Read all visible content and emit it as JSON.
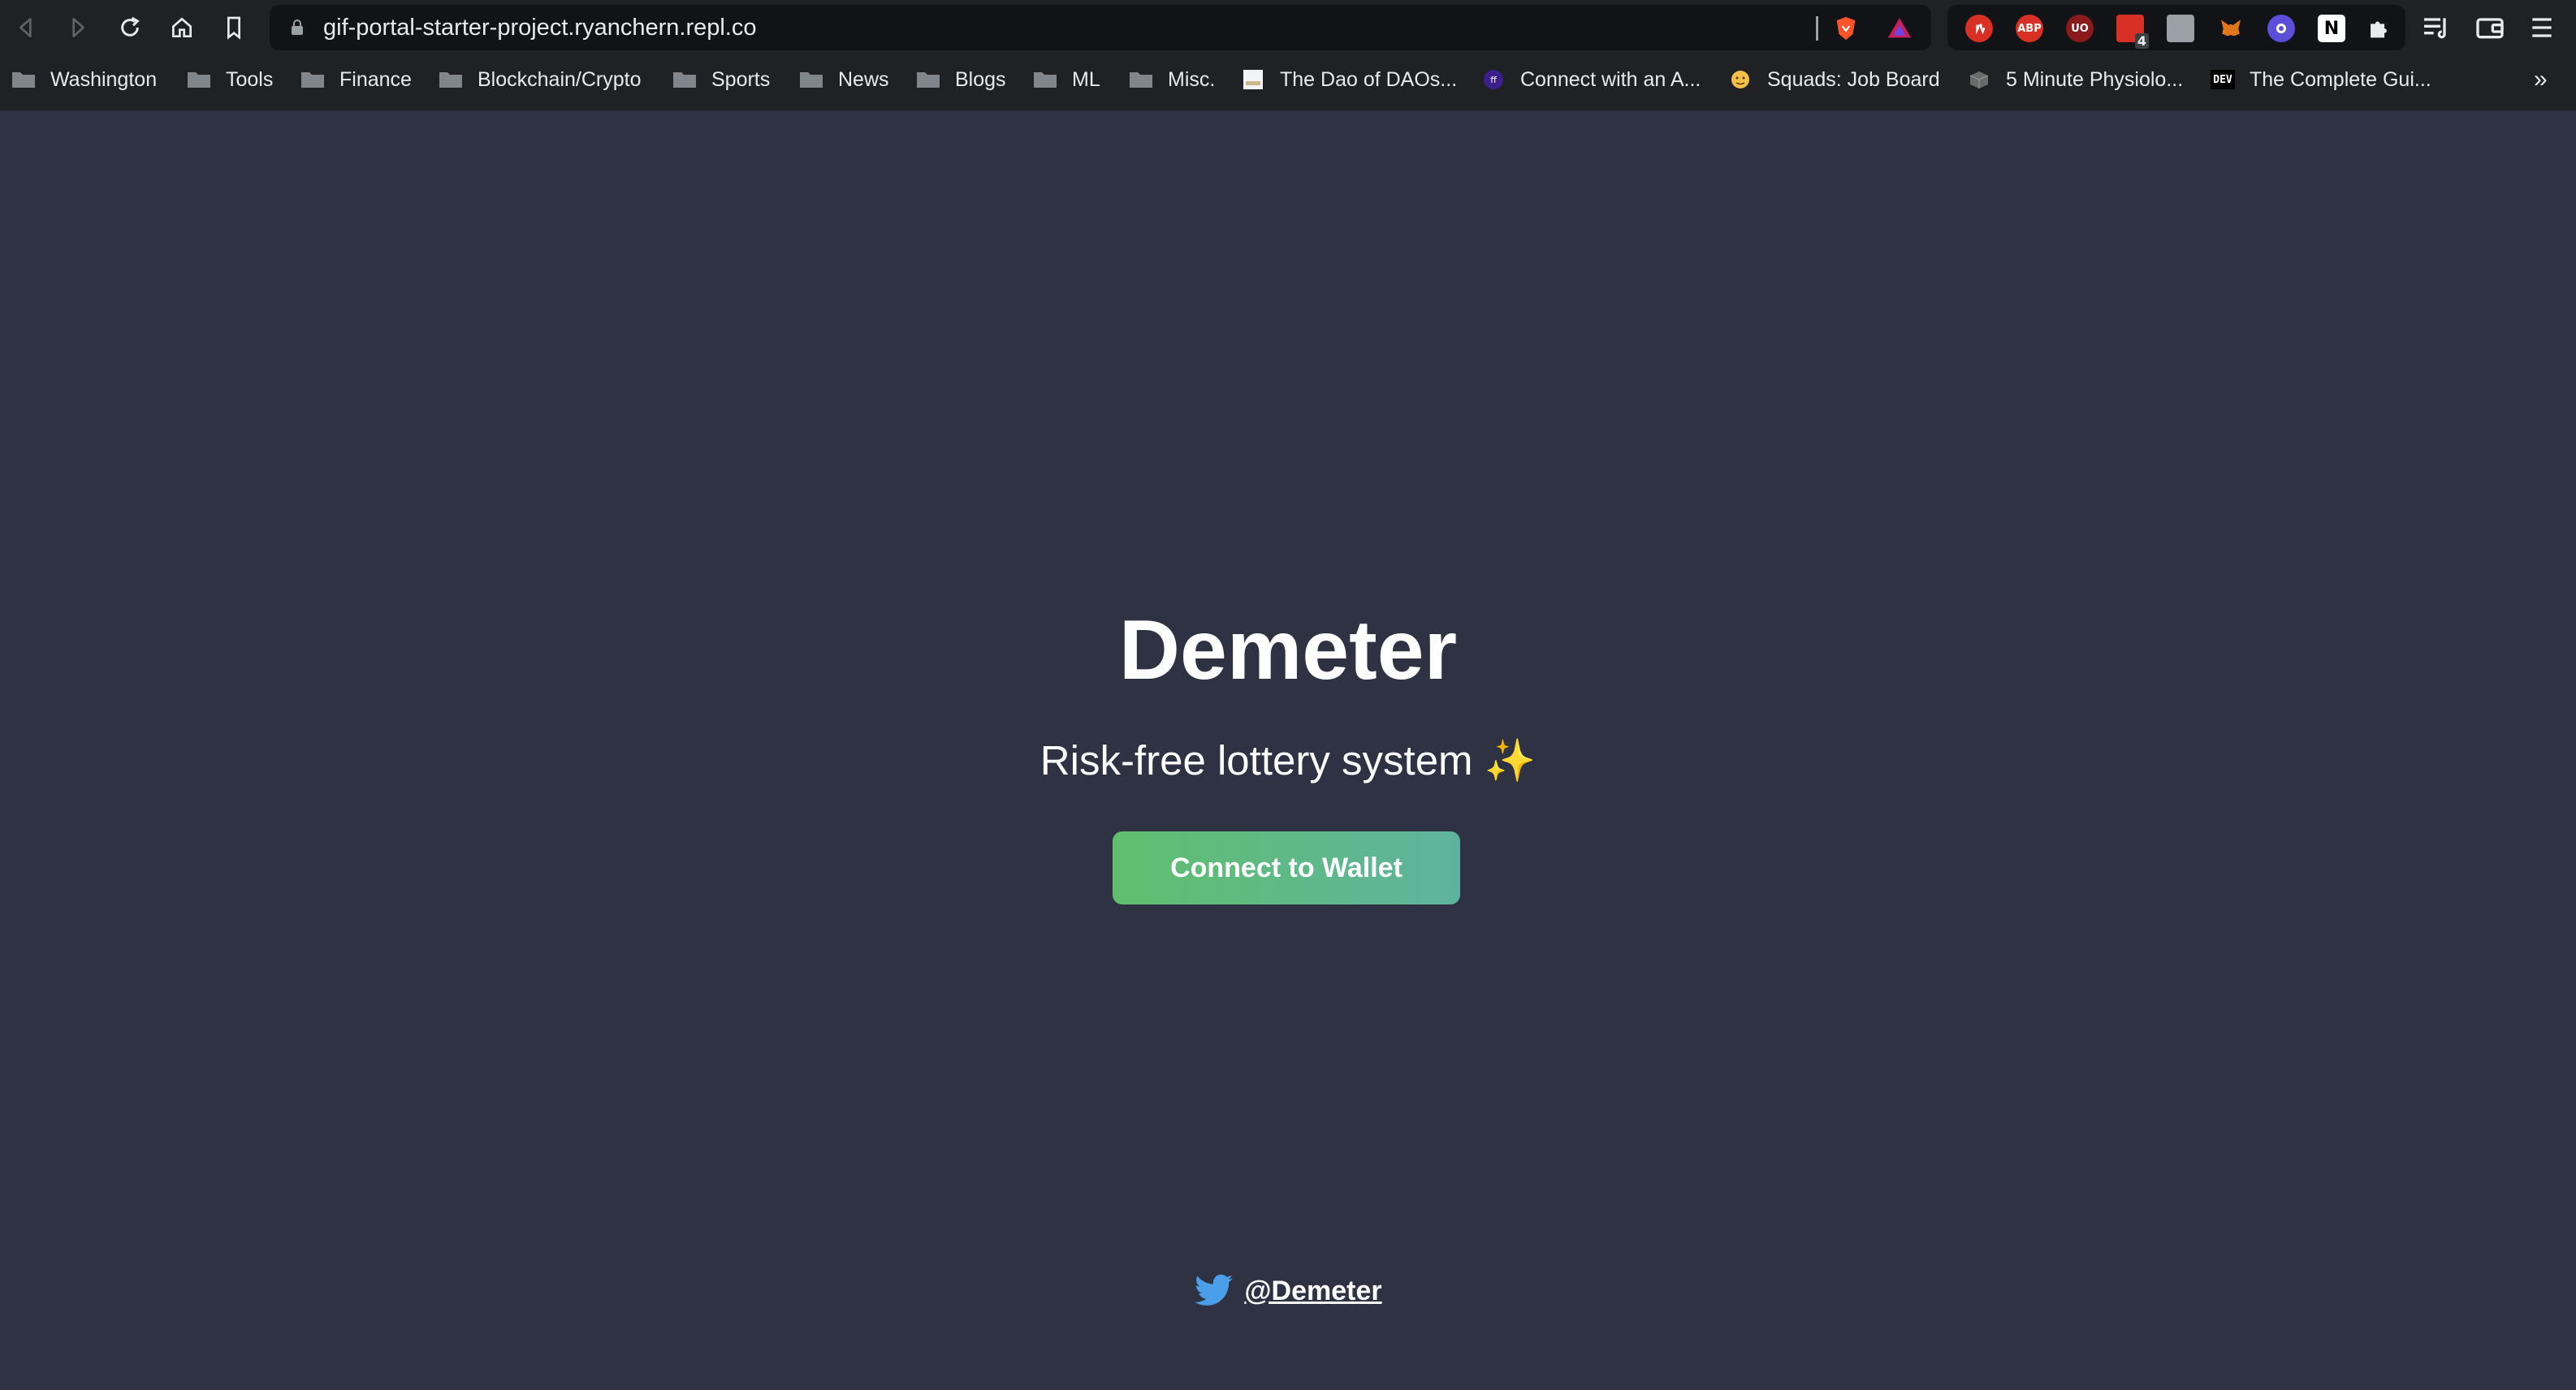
{
  "browser": {
    "url": "gif-portal-starter-project.ryanchern.repl.co",
    "extensions": [
      {
        "name": "adblock-icon",
        "label": "",
        "color": "#d93025"
      },
      {
        "name": "abp-icon",
        "label": "ABP",
        "color": "#d93025"
      },
      {
        "name": "ublock-icon",
        "label": "UO",
        "color": "#8b1a1a"
      },
      {
        "name": "calendar-extension-icon",
        "label": "",
        "color": "#d93025",
        "badge": "4"
      },
      {
        "name": "extension-gray-icon",
        "label": "",
        "color": "#9aa0a6"
      },
      {
        "name": "metamask-icon",
        "label": "",
        "color": "#e2761b"
      },
      {
        "name": "extension-purple-icon",
        "label": "",
        "color": "#5b4fd9"
      },
      {
        "name": "notion-icon",
        "label": "N",
        "color": "#ffffff"
      }
    ]
  },
  "bookmarks": [
    {
      "label": "Washington",
      "icon": "folder-icon"
    },
    {
      "label": "Tools",
      "icon": "folder-icon"
    },
    {
      "label": "Finance",
      "icon": "folder-icon"
    },
    {
      "label": "Blockchain/Crypto",
      "icon": "folder-icon"
    },
    {
      "label": "Sports",
      "icon": "folder-icon"
    },
    {
      "label": "News",
      "icon": "folder-icon"
    },
    {
      "label": "Blogs",
      "icon": "folder-icon"
    },
    {
      "label": "ML",
      "icon": "folder-icon"
    },
    {
      "label": "Misc.",
      "icon": "folder-icon"
    },
    {
      "label": "The Dao of DAOs...",
      "icon": "page-favicon-icon"
    },
    {
      "label": "Connect with an A...",
      "icon": "purple-favicon-icon"
    },
    {
      "label": "Squads: Job Board",
      "icon": "emoji-favicon-icon"
    },
    {
      "label": "5 Minute Physiolo...",
      "icon": "cube-favicon-icon"
    },
    {
      "label": "The Complete Gui...",
      "icon": "dev-favicon-icon",
      "icon_text": "DEV"
    }
  ],
  "bookmarks_more": "»",
  "main": {
    "title": "Demeter",
    "subtitle": "Risk-free lottery system ✨",
    "connect_button": "Connect to Wallet",
    "twitter_handle": "@Demeter",
    "button_gradient": [
      "#5fbf6e",
      "#5fb39e"
    ],
    "background": "#2e3243"
  }
}
